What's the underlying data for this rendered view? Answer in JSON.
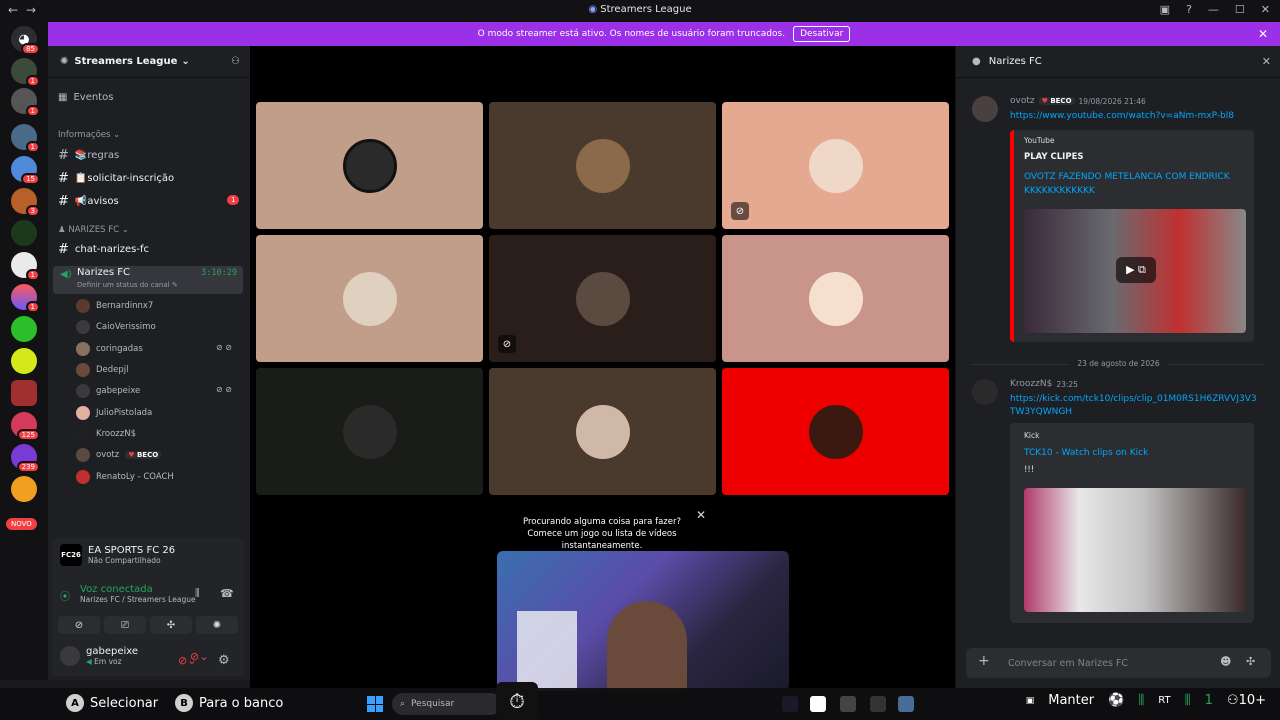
{
  "window": {
    "title": "Streamers League"
  },
  "banner": {
    "text": "O modo streamer está ativo. Os nomes de usuário foram truncados.",
    "button": "Desativar"
  },
  "guilds": {
    "badges": [
      "85",
      "1",
      "1",
      "1",
      "15",
      "3",
      "1",
      "1",
      "125",
      "239"
    ],
    "novo": "NOVO"
  },
  "server": {
    "name": "Streamers League"
  },
  "channels": {
    "events": "Eventos",
    "cat_info": "Informações",
    "regras": "📚regras",
    "solicitar": "📋solicitar-inscrição",
    "avisos": "📢avisos",
    "avisos_badge": "1",
    "cat_narizes": "NARIZES FC",
    "chat": "chat-narizes-fc",
    "voice": "Narizes FC",
    "voice_time": "3:10:29",
    "voice_status": "Definir um status do canal"
  },
  "voice_users": [
    {
      "name": "Bernardinnx7"
    },
    {
      "name": "CaioVerissimo"
    },
    {
      "name": "coringadas"
    },
    {
      "name": "Dedepjl"
    },
    {
      "name": "gabepeixe"
    },
    {
      "name": "JulioPistolada"
    },
    {
      "name": "KroozzN$"
    },
    {
      "name": "ovotz",
      "tag": "BECO"
    },
    {
      "name": "RenatoLy - COACH"
    }
  ],
  "panel": {
    "game_title": "EA SPORTS FC 26",
    "game_sub": "Não Compartilhado",
    "game_icon": "FC26",
    "voice_title": "Voz conectada",
    "voice_sub": "Narizes FC / Streamers League",
    "user_name": "gabepeixe",
    "user_status": "Em voz"
  },
  "toast": {
    "text": "Procurando alguma coisa para fazer? Comece um jogo ou lista de vídeos instantaneamente."
  },
  "chat": {
    "title": "Narizes FC",
    "msg1": {
      "author": "ovotz",
      "tag": "BECO",
      "time": "19/08/2026 21:46",
      "link": "https://www.youtube.com/watch?v=aNm-mxP-bl8",
      "provider": "YouTube",
      "embed_author": "PLAY CLIPES",
      "embed_title": "OVOTZ FAZENDO METELANCIA COM ENDRICK KKKKKKKKKKKK"
    },
    "date_sep": "23 de agosto de 2026",
    "msg2": {
      "author": "KroozzN$",
      "time": "23:25",
      "link": "https://kick.com/tck10/clips/clip_01M0RS1H6ZRVVJ3V3TW3YQWNGH",
      "provider": "Kick",
      "embed_title": "TCK10 - Watch clips on Kick",
      "embed_desc": "!!!"
    },
    "placeholder": "Conversar em Narizes FC"
  },
  "taskbar": {
    "hint_a_key": "A",
    "hint_a": "Selecionar",
    "hint_b_key": "B",
    "hint_b": "Para o banco",
    "search": "Pesquisar",
    "right_label": "Manter",
    "right_count1": "1",
    "right_count2": "10+"
  },
  "colors": {
    "accent": "#9b30e8",
    "voice_green": "#23a55a",
    "link": "#00a8fc",
    "mention_red": "#f23f43"
  }
}
